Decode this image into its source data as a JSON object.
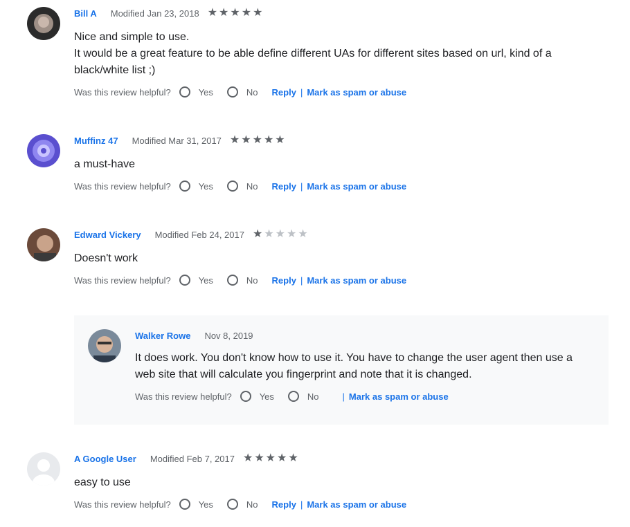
{
  "helpful_question": "Was this review helpful?",
  "yes_label": "Yes",
  "no_label": "No",
  "reply_label": "Reply",
  "separator": "|",
  "spam_label": "Mark as spam or abuse",
  "colors": {
    "link": "#1a73e8",
    "star_on": "#5f6368",
    "star_off": "#bdc1c6",
    "reply_bg": "#f8f9fa"
  },
  "reviews": [
    {
      "author": "Bill A",
      "modified": "Modified Jan 23, 2018",
      "rating": 5,
      "body": "Nice and simple to use.\nIt would be a great feature to be able define different UAs for different sites based on url, kind of a black/white list ;)"
    },
    {
      "author": "Muffinz 47",
      "modified": "Modified Mar 31, 2017",
      "rating": 5,
      "body": "a must-have"
    },
    {
      "author": "Edward Vickery",
      "modified": "Modified Feb 24, 2017",
      "rating": 1,
      "body": "Doesn't work"
    },
    {
      "author": "A Google User",
      "modified": "Modified Feb 7, 2017",
      "rating": 5,
      "body": "easy to use"
    }
  ],
  "reply": {
    "author": "Walker Rowe",
    "date": "Nov 8, 2019",
    "body": "It does work.  You don't know how to use it.  You have to change the user agent then use a web site that will calculate you fingerprint and note that it is changed."
  }
}
